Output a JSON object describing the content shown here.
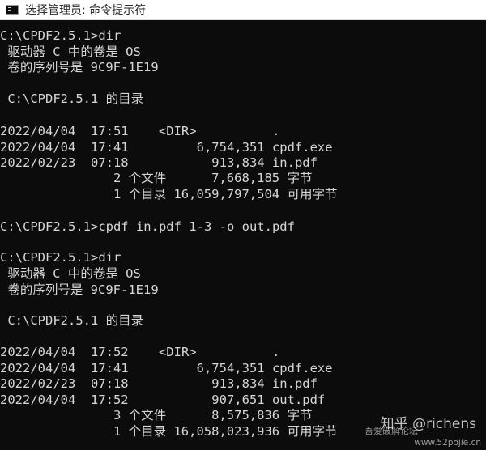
{
  "window": {
    "title": "选择管理员: 命令提示符",
    "icon": "console-app-icon"
  },
  "console": {
    "lines": [
      "C:\\CPDF2.5.1>dir",
      " 驱动器 C 中的卷是 OS",
      " 卷的序列号是 9C9F-1E19",
      "",
      " C:\\CPDF2.5.1 的目录",
      "",
      "2022/04/04  17:51    <DIR>          .",
      "2022/04/04  17:41         6,754,351 cpdf.exe",
      "2022/02/23  07:18           913,834 in.pdf",
      "               2 个文件      7,668,185 字节",
      "               1 个目录 16,059,797,504 可用字节",
      "",
      "C:\\CPDF2.5.1>cpdf in.pdf 1-3 -o out.pdf",
      "",
      "C:\\CPDF2.5.1>dir",
      " 驱动器 C 中的卷是 OS",
      " 卷的序列号是 9C9F-1E19",
      "",
      " C:\\CPDF2.5.1 的目录",
      "",
      "2022/04/04  17:52    <DIR>          .",
      "2022/04/04  17:41         6,754,351 cpdf.exe",
      "2022/02/23  07:18           913,834 in.pdf",
      "2022/04/04  17:52           907,651 out.pdf",
      "               3 个文件      8,575,836 字节",
      "               1 个目录 16,058,023,936 可用字节"
    ]
  },
  "watermark": {
    "main": "知乎 @richens",
    "cn": "吾爱破解论坛",
    "site": "www.52pojie.cn"
  }
}
